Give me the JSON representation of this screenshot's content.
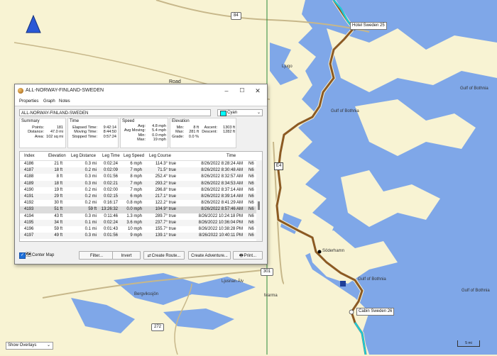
{
  "map": {
    "labels": {
      "road_84": "84",
      "road_road": "Road",
      "road_e4": "E4",
      "road_301": "301",
      "road_272": "272",
      "gulf1": "Gulf of Bothnia",
      "gulf2": "Gulf of Bothnia",
      "gulf3": "Gulf of Bothnia",
      "gulf4": "Gulf of Bothnia",
      "town_sodhamn": "Söderhamn",
      "town_ljusnan": "Ljusnan Älv",
      "place_ljugo": "Ljugo",
      "place_berg": "Bergvikssjön",
      "place_marma": "Marma",
      "hotel": "Hotel Sweden 25",
      "cabin": "Cabin Sweden 26",
      "scale": "5 mi"
    },
    "overlays_select": "Show Overlays"
  },
  "dialog": {
    "title": "ALL-NORWAY-FINLAND-SWEDEN",
    "tabs": [
      "Properties",
      "Graph",
      "Notes"
    ],
    "name_value": "ALL-NORWAY-FINLAND-SWEDEN",
    "color": {
      "name": "Cyan",
      "hex": "#00ffff"
    },
    "summary": {
      "title": "Summary",
      "rows": [
        {
          "k": "Points:",
          "v": "181"
        },
        {
          "k": "Distance:",
          "v": "47.0 mi"
        },
        {
          "k": "Area:",
          "v": "102 sq mi"
        }
      ]
    },
    "time": {
      "title": "Time",
      "rows": [
        {
          "k": "Elapsed Time:",
          "v": "9:42:14"
        },
        {
          "k": "Moving Time:",
          "v": "8:44:50"
        },
        {
          "k": "Stopped Time:",
          "v": "0:57:24"
        }
      ]
    },
    "speed": {
      "title": "Speed",
      "rows": [
        {
          "k": "Avg:",
          "v": "4.8 mph"
        },
        {
          "k": "Avg Moving:",
          "v": "5.4 mph"
        },
        {
          "k": "Min:",
          "v": "0.0 mph"
        },
        {
          "k": "Max:",
          "v": "19 mph"
        }
      ]
    },
    "elevation": {
      "title": "Elevation",
      "rows": [
        {
          "k": "Min:",
          "v": "8 ft",
          "k2": "Ascent:",
          "v2": "1303 ft"
        },
        {
          "k": "Max:",
          "v": "281 ft",
          "k2": "Descent:",
          "v2": "1282 ft"
        },
        {
          "k": "Grade:",
          "v": "0.0 %",
          "k2": "",
          "v2": ""
        }
      ]
    },
    "table": {
      "headers": [
        "Index",
        "Elevation",
        "Leg Distance",
        "Leg Time",
        "Leg Speed",
        "Leg Course",
        "Time",
        ""
      ],
      "rows": [
        [
          "4186",
          "21 ft",
          "0.3 mi",
          "0:02:24",
          "6 mph",
          "114.3° true",
          "8/26/2022 8:28:24 AM",
          "N6"
        ],
        [
          "4187",
          "18 ft",
          "0.2 mi",
          "0:02:09",
          "7 mph",
          "71.5° true",
          "8/26/2022 8:30:48 AM",
          "N6"
        ],
        [
          "4188",
          "8 ft",
          "0.3 mi",
          "0:01:56",
          "8 mph",
          "252.4° true",
          "8/26/2022 8:32:57 AM",
          "N6"
        ],
        [
          "4189",
          "18 ft",
          "0.3 mi",
          "0:02:21",
          "7 mph",
          "293.2° true",
          "8/26/2022 8:34:53 AM",
          "N6"
        ],
        [
          "4190",
          "19 ft",
          "0.2 mi",
          "0:02:00",
          "7 mph",
          "296.8° true",
          "8/26/2022 8:37:14 AM",
          "N6"
        ],
        [
          "4191",
          "29 ft",
          "0.2 mi",
          "0:02:15",
          "6 mph",
          "217.1° true",
          "8/26/2022 8:39:14 AM",
          "N6"
        ],
        [
          "4192",
          "30 ft",
          "0.2 mi",
          "0:16:17",
          "0.8 mph",
          "122.2° true",
          "8/26/2022 8:41:29 AM",
          "N6"
        ],
        [
          "4193",
          "51 ft",
          "59 ft",
          "13:26:32",
          "0.0 mph",
          "104.9° true",
          "8/26/2022 8:57:46 AM",
          "N6"
        ],
        [
          "4194",
          "43 ft",
          "0.3 mi",
          "0:11:46",
          "1.3 mph",
          "289.7° true",
          "8/26/2022 10:24:18 PM",
          "N6"
        ],
        [
          "4195",
          "34 ft",
          "0.1 mi",
          "0:02:24",
          "3.6 mph",
          "237.7° true",
          "8/26/2022 10:36:04 PM",
          "N6"
        ],
        [
          "4196",
          "59 ft",
          "0.1 mi",
          "0:01:43",
          "10 mph",
          "155.7° true",
          "8/26/2022 10:38:28 PM",
          "N6"
        ],
        [
          "4197",
          "49 ft",
          "0.3 mi",
          "0:01:56",
          "9 mph",
          "139.1° true",
          "8/26/2022 10:40:11 PM",
          "N6"
        ]
      ]
    },
    "center_map_label": "Center Map",
    "buttons": {
      "filter": "Filter...",
      "invert": "Invert",
      "create_route": "Create Route...",
      "create_adventure": "Create Adventure...",
      "print": "Print..."
    }
  }
}
